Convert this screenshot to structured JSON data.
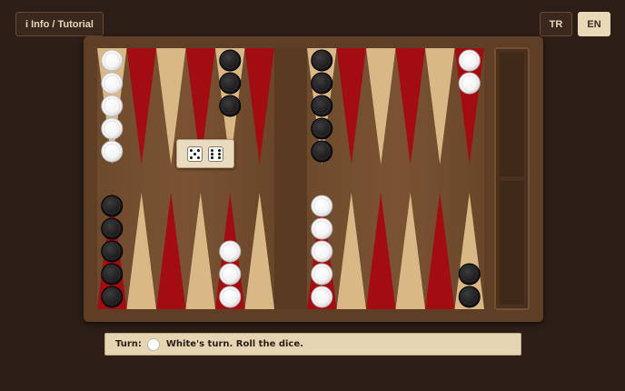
{
  "header": {
    "info_label": "i Info / Tutorial",
    "lang_tr": "TR",
    "lang_en": "EN"
  },
  "status": {
    "turn_label": "Turn:",
    "message": "White's turn. Roll the dice."
  },
  "dice": [
    5,
    6
  ],
  "colors": {
    "background": "#2c1d16",
    "frame": "#5e3e25",
    "point_red": "#a30d12",
    "point_tan": "#d9b886",
    "white_checker": "#ffffff",
    "black_checker": "#1c1c1c"
  },
  "points_top": [
    {
      "color": "tan",
      "checkers": {
        "color": "white",
        "count": 5
      }
    },
    {
      "color": "red",
      "checkers": null
    },
    {
      "color": "tan",
      "checkers": null
    },
    {
      "color": "red",
      "checkers": null
    },
    {
      "color": "tan",
      "checkers": {
        "color": "black",
        "count": 3
      }
    },
    {
      "color": "red",
      "checkers": null
    },
    {
      "color": "tan",
      "checkers": {
        "color": "black",
        "count": 5
      }
    },
    {
      "color": "red",
      "checkers": null
    },
    {
      "color": "tan",
      "checkers": null
    },
    {
      "color": "red",
      "checkers": null
    },
    {
      "color": "tan",
      "checkers": null
    },
    {
      "color": "red",
      "checkers": {
        "color": "white",
        "count": 2
      }
    }
  ],
  "points_bottom": [
    {
      "color": "red",
      "checkers": {
        "color": "black",
        "count": 5
      }
    },
    {
      "color": "tan",
      "checkers": null
    },
    {
      "color": "red",
      "checkers": null
    },
    {
      "color": "tan",
      "checkers": null
    },
    {
      "color": "red",
      "checkers": {
        "color": "white",
        "count": 3
      }
    },
    {
      "color": "tan",
      "checkers": null
    },
    {
      "color": "red",
      "checkers": {
        "color": "white",
        "count": 5
      }
    },
    {
      "color": "tan",
      "checkers": null
    },
    {
      "color": "red",
      "checkers": null
    },
    {
      "color": "tan",
      "checkers": null
    },
    {
      "color": "red",
      "checkers": null
    },
    {
      "color": "tan",
      "checkers": {
        "color": "black",
        "count": 2
      }
    }
  ]
}
